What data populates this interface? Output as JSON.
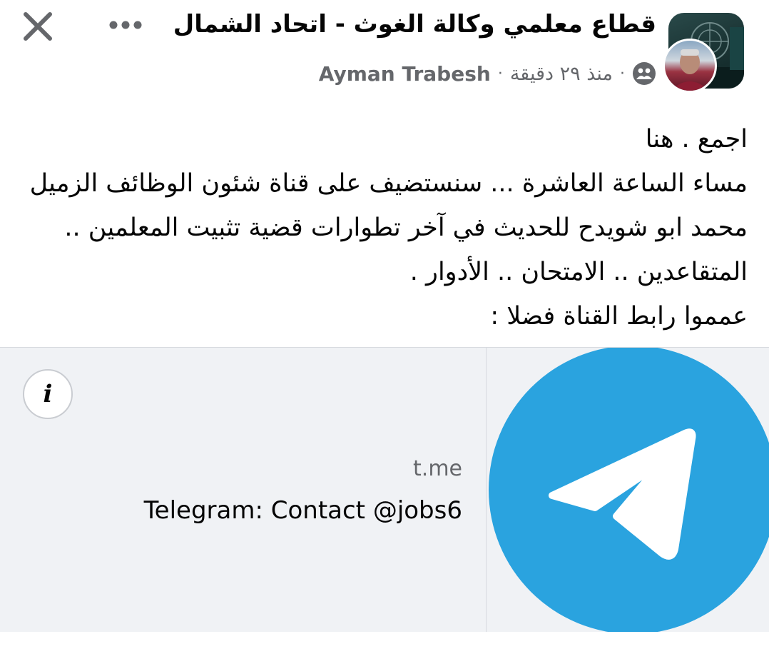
{
  "header": {
    "group_title": "قطاع معلمي وكالة الغوث - اتحاد الشمال",
    "author": "Ayman Trabesh",
    "time": "منذ ٢٩ دقيقة",
    "separator": "·",
    "audience_icon": "group-audience-icon",
    "close_icon": "close-icon",
    "more_icon": "more-options-icon"
  },
  "post": {
    "lines": [
      "اجمع . هنا",
      "مساء الساعة العاشرة ... سنستضيف على قناة شئون الوظائف الزميل",
      "محمد ابو شويدح للحديث في آخر تطوارات قضية تثبيت المعلمين ..",
      "المتقاعدين .. الامتحان .. الأدوار .",
      "عمموا رابط القناة فضلا :"
    ]
  },
  "link_preview": {
    "domain": "t.me",
    "title": "Telegram: Contact @jobs6",
    "info_label": "i",
    "thumbnail_icon": "telegram-logo-icon",
    "brand_color": "#2aa3df"
  }
}
